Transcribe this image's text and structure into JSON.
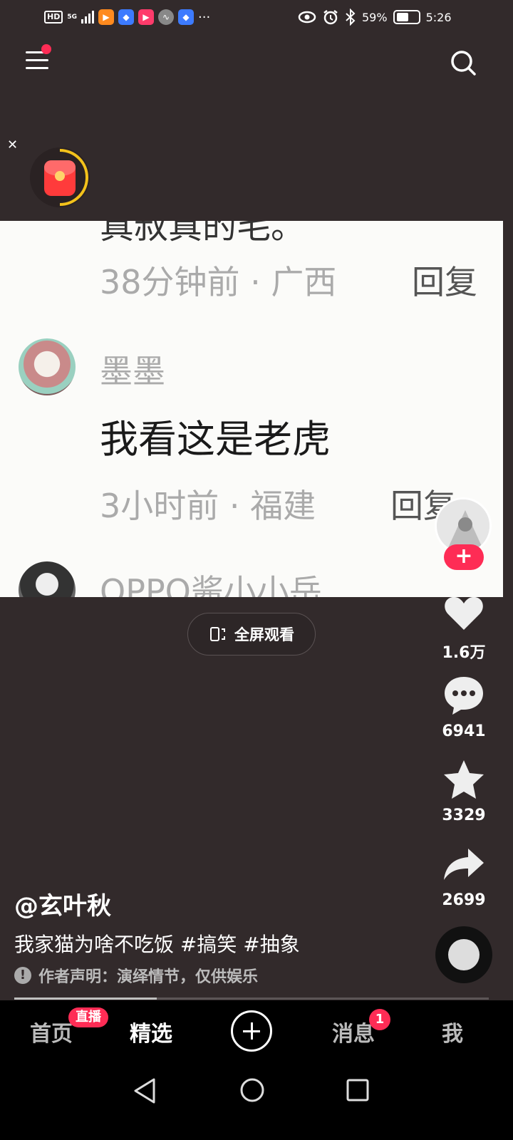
{
  "status_bar": {
    "hd": "HD",
    "network": "5G",
    "battery_percent": "59%",
    "time": "5:26",
    "more": "···"
  },
  "comments": {
    "partial_top_text": "真叔真的毛。",
    "first_meta": {
      "time_location": "38分钟前 · 广西",
      "reply": "回复"
    },
    "items": [
      {
        "username": "墨墨",
        "text": "我看这是老虎",
        "time_location": "3小时前 · 福建",
        "reply": "回复"
      },
      {
        "username": "OPPO酱小小岳"
      }
    ]
  },
  "fullscreen_button": {
    "label": "全屏观看"
  },
  "actions": {
    "likes": "1.6万",
    "comments": "6941",
    "favorites": "3329",
    "shares": "2699"
  },
  "video": {
    "author": "@玄叶秋",
    "description": "我家猫为啥不吃饭 #搞笑 #抽象",
    "disclaimer_icon": "!",
    "disclaimer": "作者声明：演绎情节，仅供娱乐",
    "progress": 0.3
  },
  "tabbar": {
    "home": "首页",
    "live_badge": "直播",
    "featured": "精选",
    "messages": "消息",
    "messages_badge": "1",
    "me": "我"
  },
  "colors": {
    "accent": "#fe2c55",
    "background": "#322a2b"
  }
}
